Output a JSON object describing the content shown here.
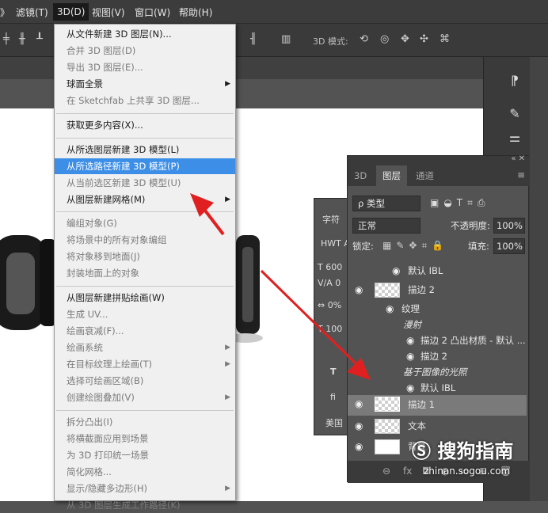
{
  "menubar": {
    "items": [
      "》",
      "滤镜(T)",
      "3D(D)",
      "视图(V)",
      "窗口(W)",
      "帮助(H)"
    ]
  },
  "options_bar": {
    "mode_label": "3D 模式:"
  },
  "menu_3d": {
    "items": [
      {
        "label": "从文件新建 3D 图层(N)...",
        "state": "normal"
      },
      {
        "label": "合并 3D 图层(D)",
        "state": "disabled"
      },
      {
        "label": "导出 3D 图层(E)...",
        "state": "disabled"
      },
      {
        "label": "球面全景",
        "state": "normal",
        "submenu": true
      },
      {
        "label": "在 Sketchfab 上共享 3D 图层...",
        "state": "disabled"
      },
      {
        "label": "获取更多内容(X)...",
        "state": "normal"
      },
      {
        "label": "从所选图层新建 3D 模型(L)",
        "state": "normal"
      },
      {
        "label": "从所选路径新建 3D 模型(P)",
        "state": "highlighted"
      },
      {
        "label": "从当前选区新建 3D 模型(U)",
        "state": "disabled"
      },
      {
        "label": "从图层新建网格(M)",
        "state": "normal",
        "submenu": true
      },
      {
        "label": "编组对象(G)",
        "state": "disabled"
      },
      {
        "label": "将场景中的所有对象编组",
        "state": "disabled"
      },
      {
        "label": "将对象移到地面(J)",
        "state": "disabled"
      },
      {
        "label": "封装地面上的对象",
        "state": "disabled"
      },
      {
        "label": "从图层新建拼贴绘画(W)",
        "state": "normal"
      },
      {
        "label": "生成 UV...",
        "state": "disabled"
      },
      {
        "label": "绘画衰减(F)...",
        "state": "disabled"
      },
      {
        "label": "绘画系统",
        "state": "disabled",
        "submenu": true
      },
      {
        "label": "在目标纹理上绘画(T)",
        "state": "disabled",
        "submenu": true
      },
      {
        "label": "选择可绘画区域(B)",
        "state": "disabled"
      },
      {
        "label": "创建绘图叠加(V)",
        "state": "disabled",
        "submenu": true
      },
      {
        "label": "拆分凸出(I)",
        "state": "disabled"
      },
      {
        "label": "将横截面应用到场景",
        "state": "disabled"
      },
      {
        "label": "为 3D 打印统一场景",
        "state": "disabled"
      },
      {
        "label": "简化网格...",
        "state": "disabled"
      },
      {
        "label": "显示/隐藏多边形(H)",
        "state": "disabled",
        "submenu": true
      },
      {
        "label": "从 3D 图层生成工作路径(K)",
        "state": "disabled"
      }
    ]
  },
  "layers_panel": {
    "tabs": [
      "3D",
      "图层",
      "通道"
    ],
    "filter_label": "ρ 类型",
    "blend_mode": "正常",
    "opacity_label": "不透明度:",
    "opacity_value": "100%",
    "lock_label": "锁定:",
    "fill_label": "填充:",
    "fill_value": "100%",
    "rows": [
      {
        "label": "默认 IBL",
        "kind": "sub"
      },
      {
        "label": "描边 2",
        "kind": "layer"
      },
      {
        "label": "纹理",
        "kind": "sub"
      },
      {
        "label": "漫射",
        "kind": "italic"
      },
      {
        "label": "描边 2 凸出材质 - 默认 ...",
        "kind": "sub"
      },
      {
        "label": "描边 2",
        "kind": "sub"
      },
      {
        "label": "基于图像的光照",
        "kind": "italic"
      },
      {
        "label": "默认 IBL",
        "kind": "sub"
      },
      {
        "label": "描边 1",
        "kind": "layer"
      },
      {
        "label": "文本",
        "kind": "layer"
      },
      {
        "label": "背景",
        "kind": "layer"
      }
    ]
  },
  "char_panel": {
    "title": "字符",
    "font": "HWT A",
    "size": "600",
    "kerning": "0",
    "tracking": "0%",
    "scale": "100",
    "language": "美国"
  },
  "watermark": {
    "brand": "搜狗指南",
    "url": "zhinan.sogou.com"
  },
  "colors": {
    "highlight": "#3d8ee6",
    "arrow": "#e02020"
  }
}
